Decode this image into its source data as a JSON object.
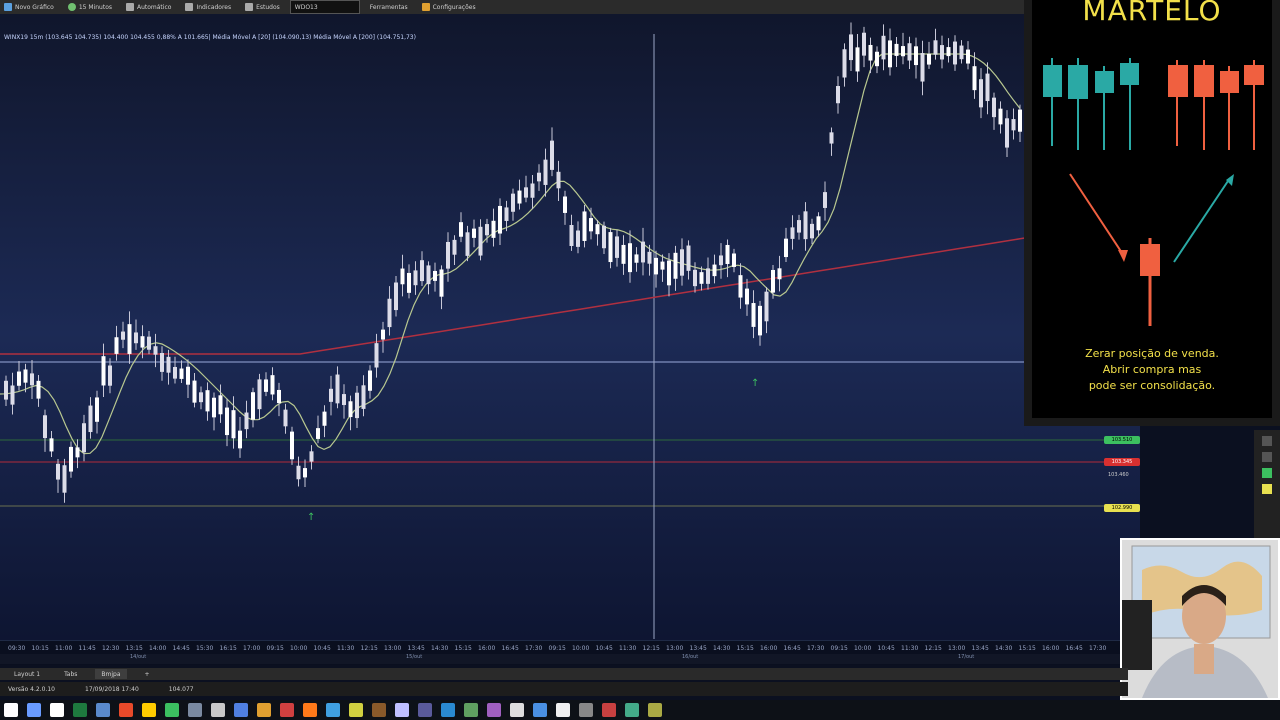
{
  "toolbar": {
    "items": [
      {
        "label": "Novo Gráfico",
        "icon": "new-chart-icon",
        "color": "#5aa0e0"
      },
      {
        "label": "15 Minutos",
        "icon": "clock-icon",
        "color": "#70c070"
      },
      {
        "label": "Automático",
        "icon": "auto-scale-icon",
        "color": "#c0c0c0"
      },
      {
        "label": "Indicadores",
        "icon": "indicator-icon",
        "color": "#c0c0c0"
      },
      {
        "label": "Estudos",
        "icon": "study-icon",
        "color": "#c0c0c0"
      },
      {
        "label": "Ferramentas",
        "icon": "tools-icon",
        "color": "#c0c0c0"
      },
      {
        "label": "Configurações",
        "icon": "settings-icon",
        "color": "#e0a030"
      }
    ],
    "zoom_value": "WDO13"
  },
  "chart": {
    "title": "WINX19 15m (103.645 104.735) 104.400 104.455 0,88% A 101.665| Média Móvel A [20] (104.090,13) Média Móvel A [200] (104.751,73)",
    "price_tags": [
      {
        "label": "103.510",
        "color": "#3cc060"
      },
      {
        "label": "103.345",
        "color": "#d83030"
      },
      {
        "label": "102.990",
        "color": "#e8e050"
      }
    ],
    "side_price": "103.460",
    "x_labels": [
      "09:30",
      "10:15",
      "11:00",
      "11:45",
      "12:30",
      "13:15",
      "14:00",
      "14:45",
      "15:30",
      "16:15",
      "17:00",
      "09:15",
      "10:00",
      "10:45",
      "11:30",
      "12:15",
      "13:00",
      "13:45",
      "14:30",
      "15:15",
      "16:00",
      "16:45",
      "17:30",
      "09:15",
      "10:00",
      "10:45",
      "11:30",
      "12:15",
      "13:00",
      "13:45",
      "14:30",
      "15:15",
      "16:00",
      "16:45",
      "17:30",
      "09:15",
      "10:00",
      "10:45",
      "11:30",
      "12:15",
      "13:00",
      "13:45",
      "14:30",
      "15:15",
      "16:00",
      "16:45",
      "17:30"
    ],
    "date_labels": [
      "14/out",
      "15/out",
      "16/out",
      "17/out"
    ],
    "colors": {
      "background_top": "#10162c",
      "background_bottom": "#1c2a55",
      "ma20": "#b8c890",
      "ma200": "#b03040",
      "candle_up": "#ffffff",
      "candle_down": "#ffffff"
    }
  },
  "martelo": {
    "title": "MARTELO",
    "lines": [
      "Zerar posição de venda.",
      "Abrir compra mas",
      "pode ser consolidação."
    ]
  },
  "bottom_tabs": [
    "Layout 1",
    "Tabs",
    "Bmjpa"
  ],
  "status": {
    "version": "Versão 4.2.0.10",
    "datetime": "17/09/2018 17:40",
    "value": "104.077"
  },
  "taskbar_icons": [
    "windows-icon",
    "search-icon",
    "task-view-icon",
    "excel-icon",
    "app-icon",
    "chrome-icon",
    "app-icon",
    "app-icon",
    "app-icon",
    "app-icon",
    "app-icon",
    "app-icon",
    "app-icon",
    "app-icon",
    "app-icon",
    "app-icon",
    "app-icon",
    "app-icon",
    "app-icon",
    "app-icon",
    "app-icon",
    "app-icon",
    "app-icon",
    "app-icon",
    "app-icon",
    "app-icon",
    "app-icon",
    "app-icon",
    "app-icon"
  ]
}
